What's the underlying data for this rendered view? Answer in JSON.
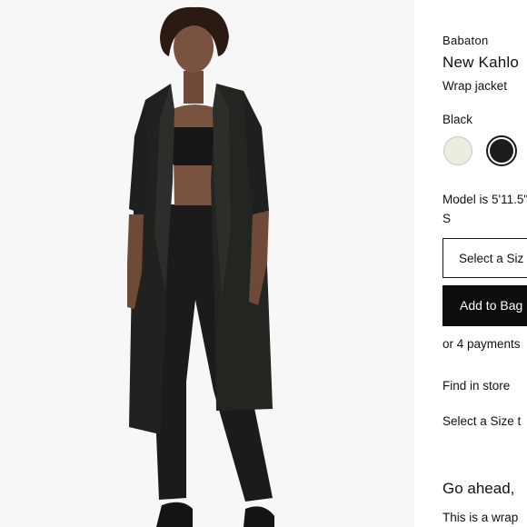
{
  "product": {
    "brand": "Babaton",
    "title": "New Kahlo",
    "subtitle": "Wrap jacket",
    "color_label": "Black",
    "swatches": [
      {
        "name": "ivory",
        "hex": "#ececdf",
        "selected": false
      },
      {
        "name": "black",
        "hex": "#1c1c1c",
        "selected": true
      }
    ],
    "model_info": "Model is 5'11.5\",",
    "model_size": "S",
    "size_select_label": "Select a Siz",
    "add_to_bag_label": "Add to Bag",
    "payments_text": "or 4 payments",
    "find_in_store_label": "Find in store",
    "size_note": "Select a Size t",
    "section_heading": "Go ahead,",
    "description": "This is a wrap"
  }
}
